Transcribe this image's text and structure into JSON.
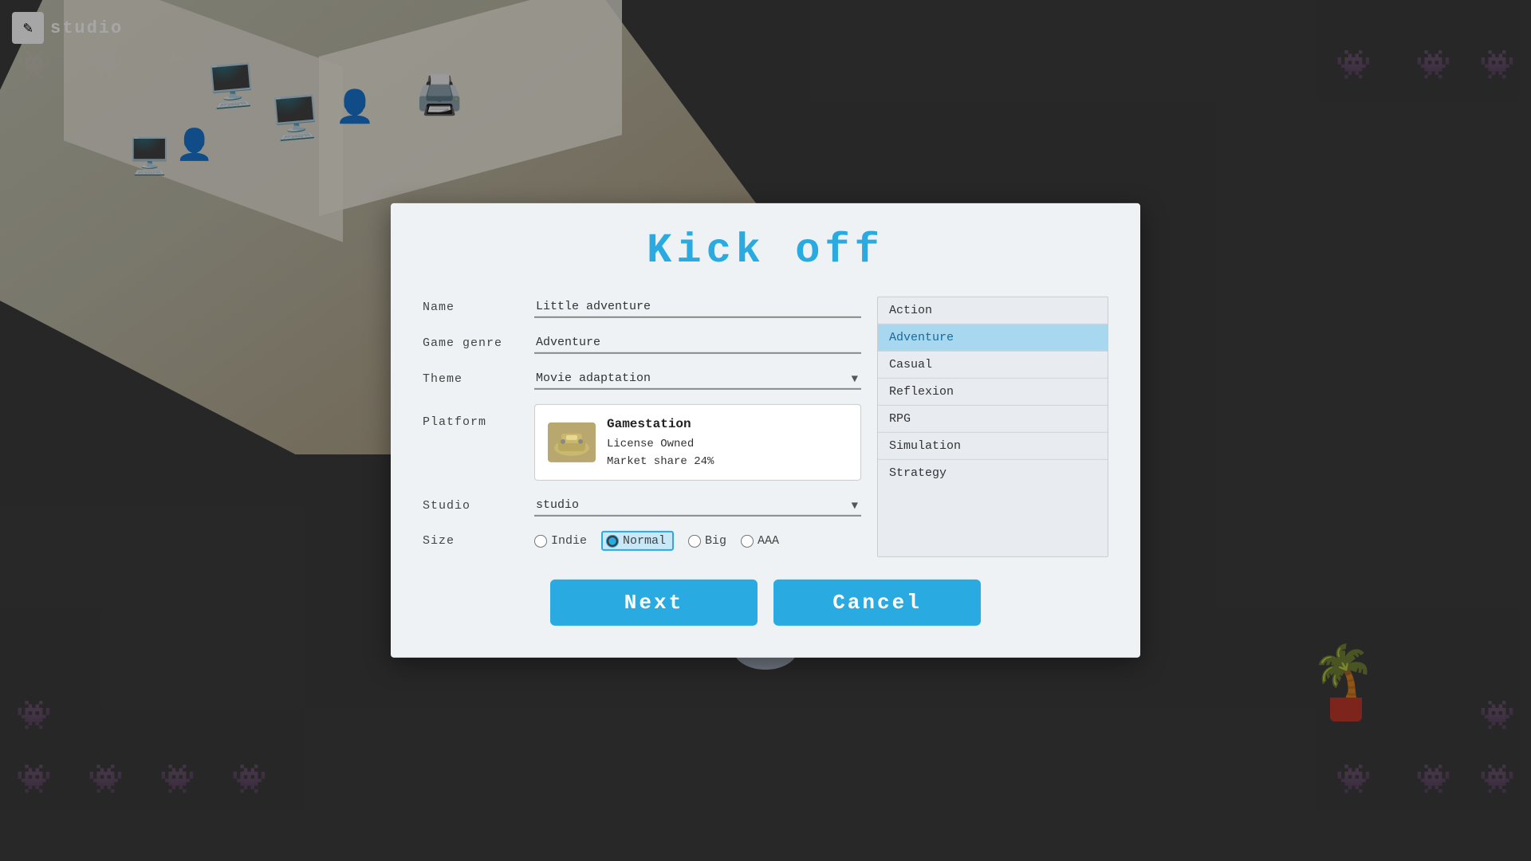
{
  "app": {
    "logo_icon": "✎",
    "logo_text": "studio"
  },
  "background": {
    "ghost_icons": [
      "👾",
      "👾",
      "👾",
      "👾",
      "👾",
      "👾",
      "👾",
      "👾",
      "👾",
      "👾",
      "👾",
      "👾",
      "👾",
      "👾",
      "👾",
      "👾"
    ]
  },
  "modal": {
    "title": "Kick  off",
    "form": {
      "name_label": "Name",
      "name_value": "Little adventure",
      "genre_label": "Game genre",
      "genre_value": "Adventure",
      "theme_label": "Theme",
      "theme_value": "Movie adaptation",
      "platform_label": "Platform",
      "platform_name": "Gamestation",
      "platform_license": "License Owned",
      "platform_market": "Market share 24%",
      "studio_label": "Studio",
      "studio_value": "studio",
      "size_label": "Size",
      "size_options": [
        {
          "id": "indie",
          "label": "Indie",
          "checked": false
        },
        {
          "id": "normal",
          "label": "Normal",
          "checked": true
        },
        {
          "id": "big",
          "label": "Big",
          "checked": false
        },
        {
          "id": "aaa",
          "label": "AAA",
          "checked": false
        }
      ]
    },
    "genres": [
      {
        "label": "Action",
        "selected": false
      },
      {
        "label": "Adventure",
        "selected": true
      },
      {
        "label": "Casual",
        "selected": false
      },
      {
        "label": "Reflexion",
        "selected": false
      },
      {
        "label": "RPG",
        "selected": false
      },
      {
        "label": "Simulation",
        "selected": false
      },
      {
        "label": "Strategy",
        "selected": false
      }
    ],
    "buttons": {
      "next_label": "Next",
      "cancel_label": "Cancel"
    }
  },
  "colors": {
    "accent": "#29abe2",
    "modal_bg": "#eef2f5",
    "selected_genre_bg": "#a8d8f0"
  }
}
